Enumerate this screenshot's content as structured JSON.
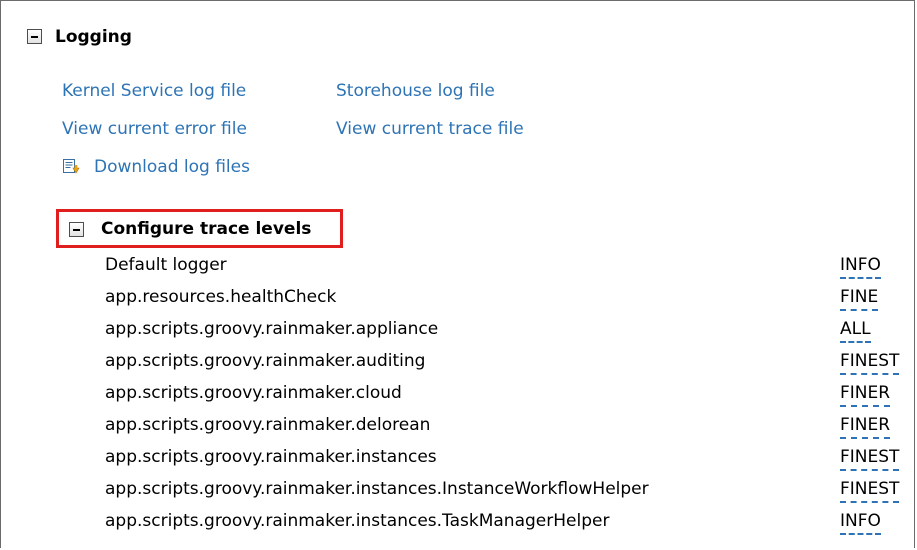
{
  "logging": {
    "title": "Logging",
    "links": {
      "kernel_log": "Kernel Service log file",
      "storehouse_log": "Storehouse log file",
      "error_file": "View current error file",
      "trace_file": "View current trace file",
      "download": "Download log files"
    },
    "download_icon": "download-log-icon"
  },
  "trace": {
    "title": "Configure trace levels",
    "highlight_color": "#e01e1e",
    "rows": [
      {
        "logger": "Default logger",
        "level": "INFO"
      },
      {
        "logger": "app.resources.healthCheck",
        "level": "FINE"
      },
      {
        "logger": "app.scripts.groovy.rainmaker.appliance",
        "level": "ALL"
      },
      {
        "logger": "app.scripts.groovy.rainmaker.auditing",
        "level": "FINEST"
      },
      {
        "logger": "app.scripts.groovy.rainmaker.cloud",
        "level": "FINER"
      },
      {
        "logger": "app.scripts.groovy.rainmaker.delorean",
        "level": "FINER"
      },
      {
        "logger": "app.scripts.groovy.rainmaker.instances",
        "level": "FINEST"
      },
      {
        "logger": "app.scripts.groovy.rainmaker.instances.InstanceWorkflowHelper",
        "level": "FINEST"
      },
      {
        "logger": "app.scripts.groovy.rainmaker.instances.TaskManagerHelper",
        "level": "INFO"
      }
    ]
  },
  "colors": {
    "link": "#2e74b5",
    "border": "#6b6b6b"
  }
}
